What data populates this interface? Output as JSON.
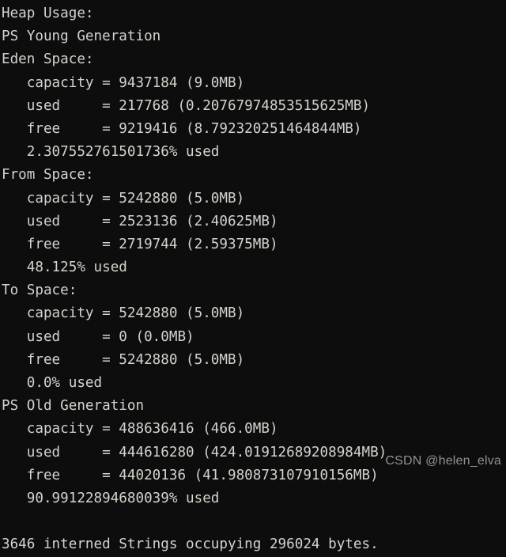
{
  "terminal": {
    "background_color": "#0d0d0d",
    "text_color": "#d6d3cd",
    "lines": [
      "Heap Usage:",
      "PS Young Generation",
      "Eden Space:",
      "   capacity = 9437184 (9.0MB)",
      "   used     = 217768 (0.20767974853515625MB)",
      "   free     = 9219416 (8.792320251464844MB)",
      "   2.307552761501736% used",
      "From Space:",
      "   capacity = 5242880 (5.0MB)",
      "   used     = 2523136 (2.40625MB)",
      "   free     = 2719744 (2.59375MB)",
      "   48.125% used",
      "To Space:",
      "   capacity = 5242880 (5.0MB)",
      "   used     = 0 (0.0MB)",
      "   free     = 5242880 (5.0MB)",
      "   0.0% used",
      "PS Old Generation",
      "   capacity = 488636416 (466.0MB)",
      "   used     = 444616280 (424.01912689208984MB)",
      "   free     = 44020136 (41.980873107910156MB)",
      "   90.99122894680039% used",
      "",
      "3646 interned Strings occupying 296024 bytes."
    ]
  },
  "watermark": {
    "text": "CSDN @helen_elva",
    "color": "#e1e1e1"
  },
  "heap_data": {
    "header": "Heap Usage:",
    "generations": [
      {
        "name": "PS Young Generation",
        "spaces": [
          {
            "name": "Eden Space:",
            "capacity_bytes": 9437184,
            "capacity_mb": "9.0MB",
            "used_bytes": 217768,
            "used_mb": "0.20767974853515625MB",
            "free_bytes": 9219416,
            "free_mb": "8.792320251464844MB",
            "percent_used": "2.307552761501736% used"
          },
          {
            "name": "From Space:",
            "capacity_bytes": 5242880,
            "capacity_mb": "5.0MB",
            "used_bytes": 2523136,
            "used_mb": "2.40625MB",
            "free_bytes": 2719744,
            "free_mb": "2.59375MB",
            "percent_used": "48.125% used"
          },
          {
            "name": "To Space:",
            "capacity_bytes": 5242880,
            "capacity_mb": "5.0MB",
            "used_bytes": 0,
            "used_mb": "0.0MB",
            "free_bytes": 5242880,
            "free_mb": "5.0MB",
            "percent_used": "0.0% used"
          }
        ]
      },
      {
        "name": "PS Old Generation",
        "spaces": [
          {
            "name": "",
            "capacity_bytes": 488636416,
            "capacity_mb": "466.0MB",
            "used_bytes": 444616280,
            "used_mb": "424.01912689208984MB",
            "free_bytes": 44020136,
            "free_mb": "41.980873107910156MB",
            "percent_used": "90.99122894680039% used"
          }
        ]
      }
    ],
    "interned_strings_count": 3646,
    "interned_strings_bytes": 296024,
    "interned_strings_line": "3646 interned Strings occupying 296024 bytes."
  }
}
